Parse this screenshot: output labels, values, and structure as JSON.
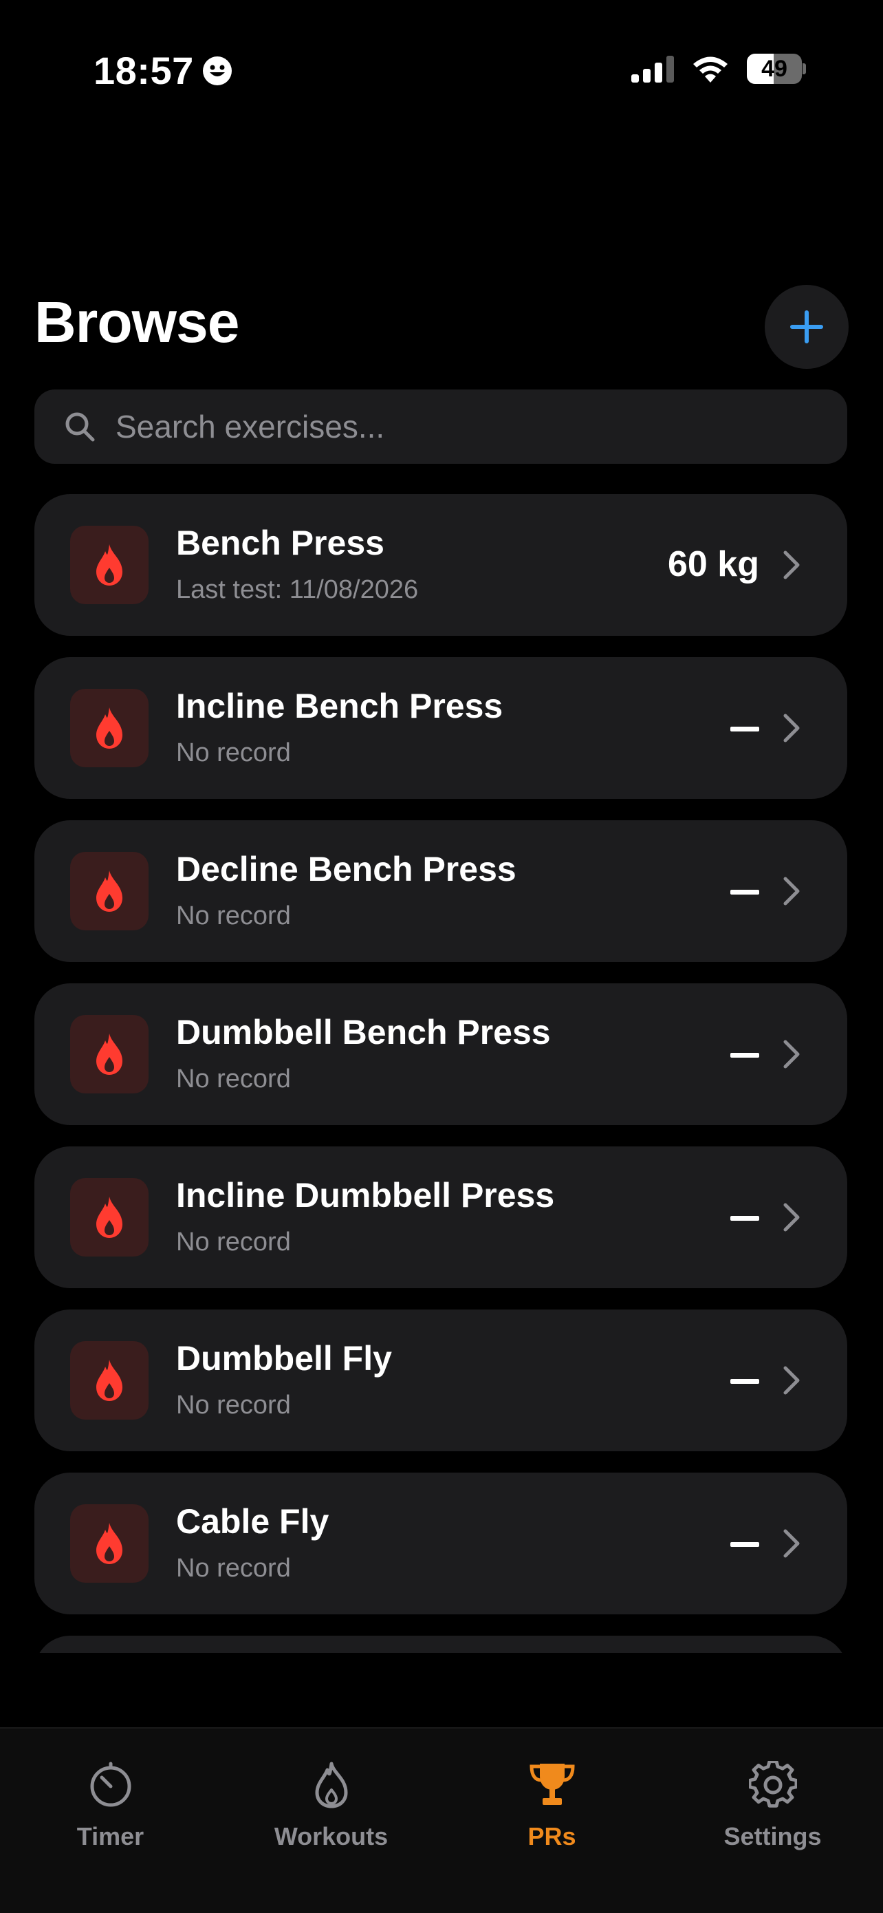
{
  "status_bar": {
    "time": "18:57",
    "battery": "49",
    "battery_level": 0.49
  },
  "header": {
    "title": "Browse"
  },
  "search": {
    "placeholder": "Search exercises..."
  },
  "exercises": [
    {
      "name": "Bench Press",
      "subtitle": "Last test: 11/08/2026",
      "value": "60 kg"
    },
    {
      "name": "Incline Bench Press",
      "subtitle": "No record",
      "value": ""
    },
    {
      "name": "Decline Bench Press",
      "subtitle": "No record",
      "value": ""
    },
    {
      "name": "Dumbbell Bench Press",
      "subtitle": "No record",
      "value": ""
    },
    {
      "name": "Incline Dumbbell Press",
      "subtitle": "No record",
      "value": ""
    },
    {
      "name": "Dumbbell Fly",
      "subtitle": "No record",
      "value": ""
    },
    {
      "name": "Cable Fly",
      "subtitle": "No record",
      "value": ""
    },
    {
      "name": "",
      "subtitle": "",
      "value": ""
    }
  ],
  "tabs": [
    {
      "label": "Timer",
      "icon": "timer-icon",
      "active": false
    },
    {
      "label": "Workouts",
      "icon": "flame-icon",
      "active": false
    },
    {
      "label": "PRs",
      "icon": "trophy-icon",
      "active": true
    },
    {
      "label": "Settings",
      "icon": "gear-icon",
      "active": false
    }
  ],
  "colors": {
    "background": "#000000",
    "card": "#1c1c1e",
    "accent_blue": "#3a9df2",
    "accent_orange": "#f08a1c",
    "flame_red": "#ff3b30",
    "muted_text": "#8e8e93"
  }
}
